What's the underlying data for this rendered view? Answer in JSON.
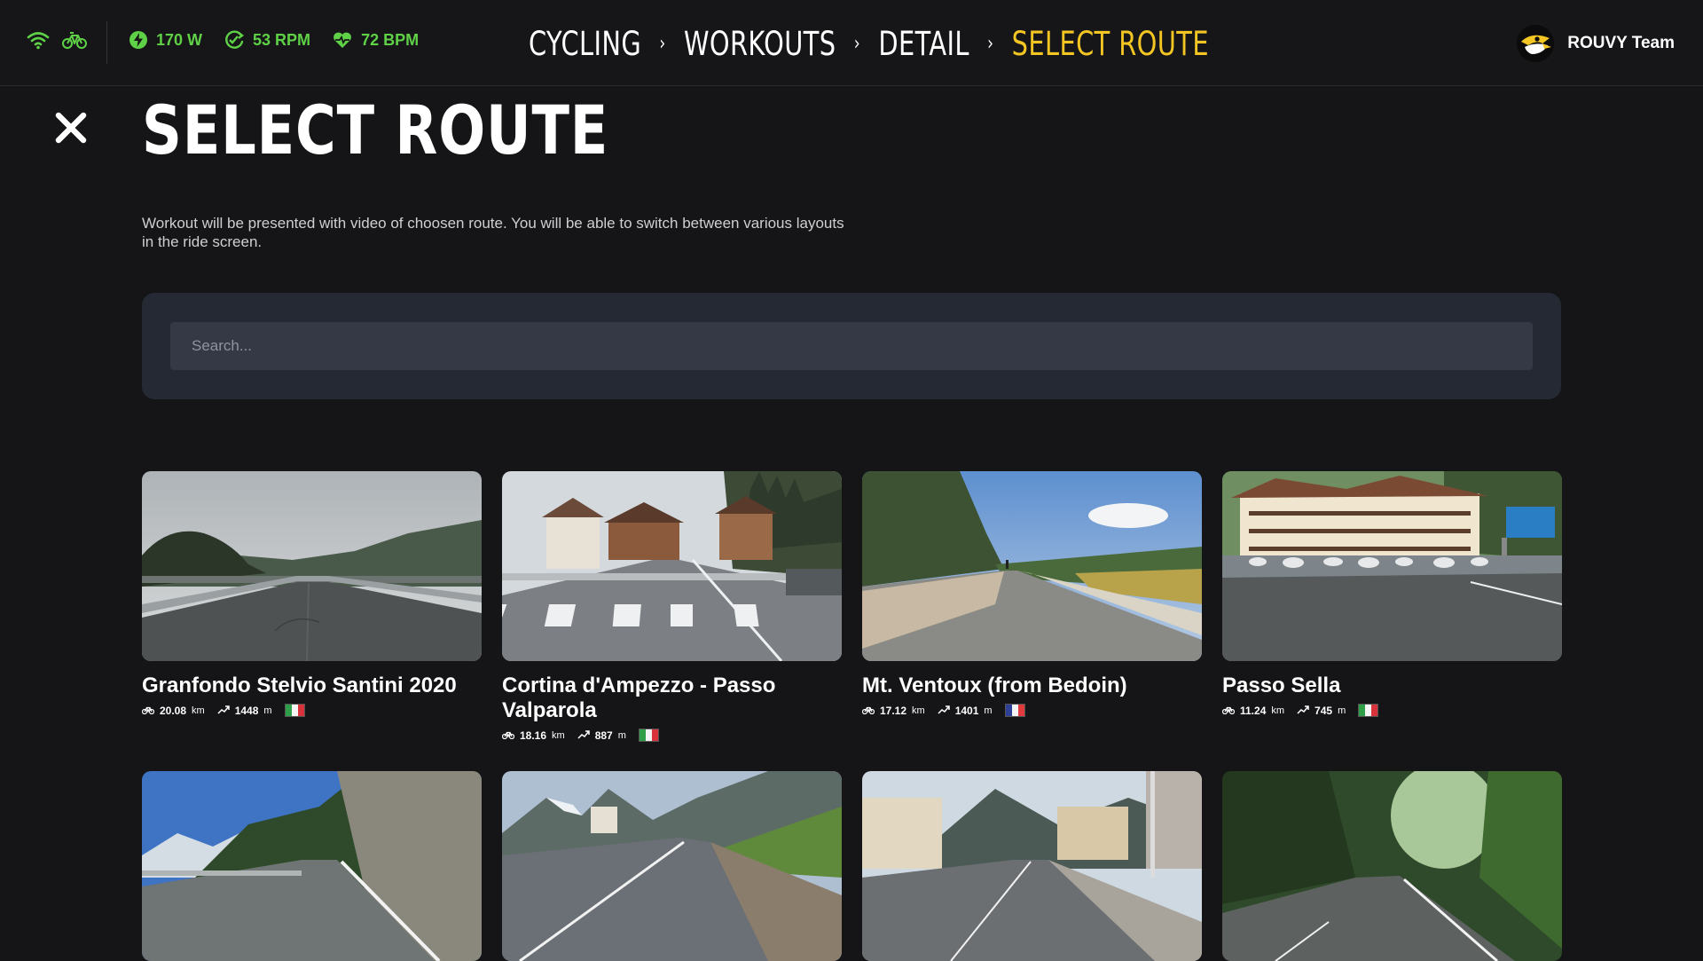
{
  "topbar": {
    "connection_icons": [
      "wifi-icon",
      "bike-sensor-icon"
    ],
    "metrics": [
      {
        "icon": "power-bolt-icon",
        "value": "170 W"
      },
      {
        "icon": "cadence-icon",
        "value": "53 RPM"
      },
      {
        "icon": "heart-rate-icon",
        "value": "72 BPM"
      }
    ],
    "breadcrumbs": [
      "CYCLING",
      "WORKOUTS",
      "DETAIL",
      "SELECT ROUTE"
    ],
    "user_name": "ROUVY Team"
  },
  "page": {
    "title": "SELECT ROUTE",
    "description": "Workout will be presented with video of choosen route. You will be able to switch between various layouts in the ride screen."
  },
  "search": {
    "placeholder": "Search...",
    "value": ""
  },
  "routes": [
    {
      "name": "Granfondo Stelvio Santini 2020",
      "distance": "20.08",
      "distance_unit": "km",
      "elevation": "1448",
      "elevation_unit": "m",
      "country": "IT"
    },
    {
      "name": "Cortina d'Ampezzo - Passo Valparola",
      "distance": "18.16",
      "distance_unit": "km",
      "elevation": "887",
      "elevation_unit": "m",
      "country": "IT"
    },
    {
      "name": "Mt. Ventoux (from Bedoin)",
      "distance": "17.12",
      "distance_unit": "km",
      "elevation": "1401",
      "elevation_unit": "m",
      "country": "FR"
    },
    {
      "name": "Passo Sella",
      "distance": "11.24",
      "distance_unit": "km",
      "elevation": "745",
      "elevation_unit": "m",
      "country": "IT"
    },
    {
      "name": "",
      "distance": "",
      "distance_unit": "",
      "elevation": "",
      "elevation_unit": "",
      "country": ""
    },
    {
      "name": "",
      "distance": "",
      "distance_unit": "",
      "elevation": "",
      "elevation_unit": "",
      "country": ""
    },
    {
      "name": "",
      "distance": "",
      "distance_unit": "",
      "elevation": "",
      "elevation_unit": "",
      "country": ""
    },
    {
      "name": "",
      "distance": "",
      "distance_unit": "",
      "elevation": "",
      "elevation_unit": "",
      "country": ""
    }
  ],
  "colors": {
    "accent_yellow": "#f3c623",
    "metric_green": "#5fd147",
    "background": "#151517",
    "panel": "#252933"
  }
}
